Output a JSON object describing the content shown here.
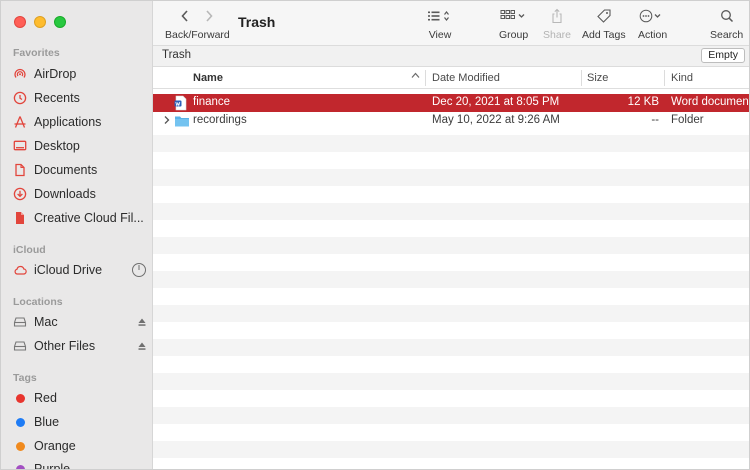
{
  "window": {
    "title": "Trash"
  },
  "toolbar": {
    "back_forward_label": "Back/Forward",
    "view_label": "View",
    "group_label": "Group",
    "share_label": "Share",
    "add_tags_label": "Add Tags",
    "action_label": "Action",
    "search_label": "Search"
  },
  "pathbar": {
    "title": "Trash",
    "empty_label": "Empty"
  },
  "columns": {
    "name": "Name",
    "date": "Date Modified",
    "size": "Size",
    "kind": "Kind"
  },
  "sidebar": {
    "favorites_label": "Favorites",
    "favorites": [
      {
        "label": "AirDrop",
        "icon": "airdrop-icon"
      },
      {
        "label": "Recents",
        "icon": "clock-icon"
      },
      {
        "label": "Applications",
        "icon": "applications-icon"
      },
      {
        "label": "Desktop",
        "icon": "desktop-icon"
      },
      {
        "label": "Documents",
        "icon": "document-icon"
      },
      {
        "label": "Downloads",
        "icon": "download-icon"
      },
      {
        "label": "Creative Cloud Fil...",
        "icon": "file-icon"
      }
    ],
    "icloud_label": "iCloud",
    "icloud": [
      {
        "label": "iCloud Drive",
        "icon": "cloud-icon"
      }
    ],
    "locations_label": "Locations",
    "locations": [
      {
        "label": "Mac",
        "icon": "disk-icon"
      },
      {
        "label": "Other Files",
        "icon": "disk-icon"
      }
    ],
    "tags_label": "Tags",
    "tags": [
      {
        "label": "Red",
        "color": "#e8352e"
      },
      {
        "label": "Blue",
        "color": "#1f7cf5"
      },
      {
        "label": "Orange",
        "color": "#f08a1e"
      },
      {
        "label": "Purple",
        "color": "#a24fc2"
      }
    ]
  },
  "files": [
    {
      "name": "finance",
      "date": "Dec 20, 2021 at 8:05 PM",
      "size": "12 KB",
      "kind": "Word document",
      "icon": "word-document-icon",
      "selected": true
    },
    {
      "name": "recordings",
      "date": "May 10, 2022 at 9:26 AM",
      "size": "--",
      "kind": "Folder",
      "icon": "folder-icon",
      "selected": false
    }
  ],
  "colors": {
    "selection": "#c1272d",
    "sidebar_accent": "#e2453c",
    "folder": "#5ab3e8"
  }
}
